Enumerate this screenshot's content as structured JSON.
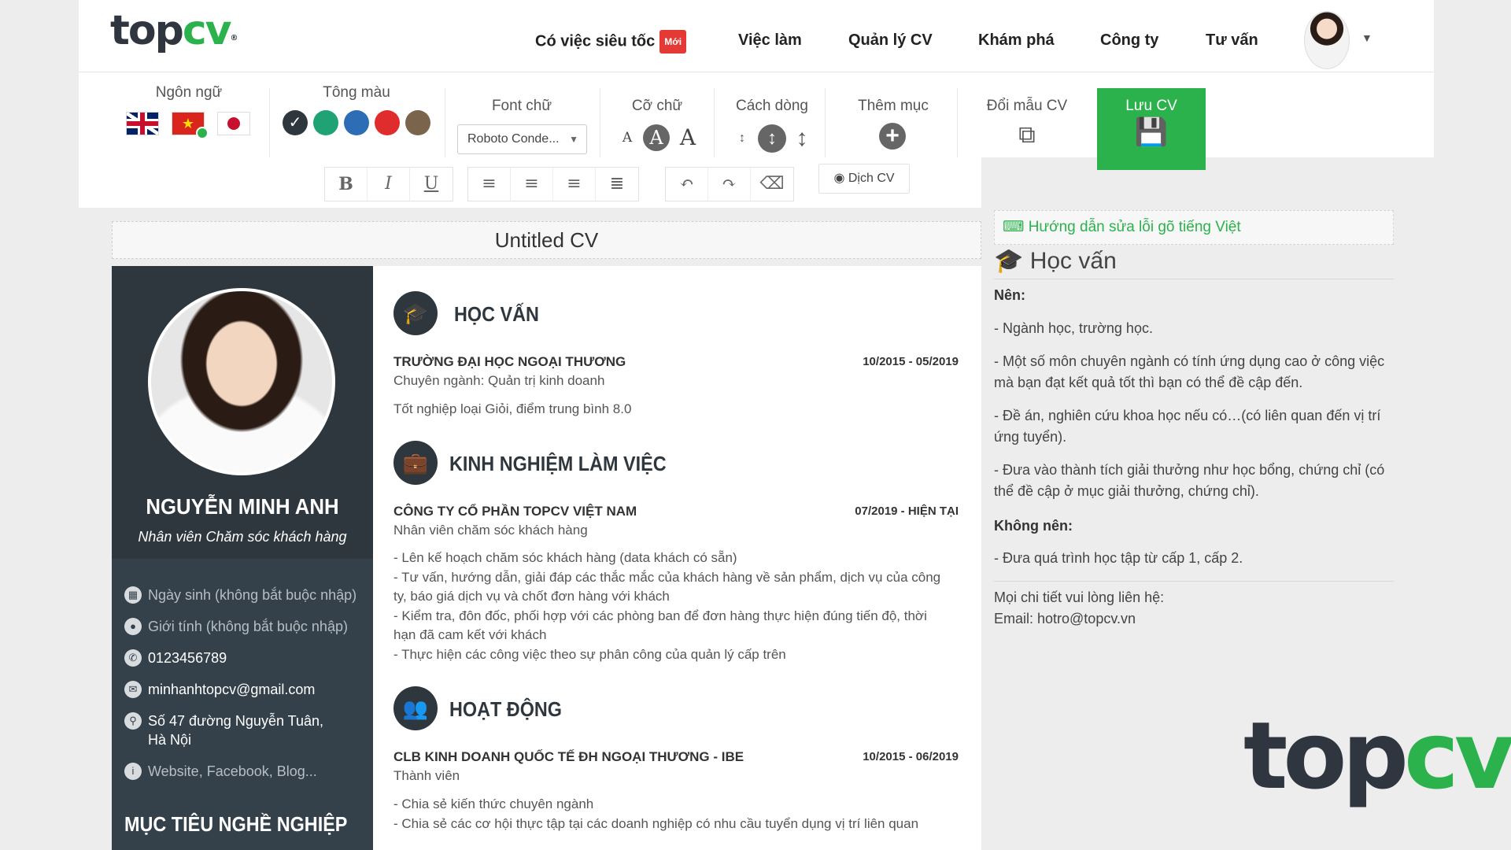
{
  "header": {
    "logo_top": "top",
    "logo_cv": "cv",
    "logo_reg": "®",
    "nav": [
      {
        "label": "Có việc siêu tốc",
        "badge": "Mới"
      },
      {
        "label": "Việc làm"
      },
      {
        "label": "Quản lý CV"
      },
      {
        "label": "Khám phá"
      },
      {
        "label": "Công ty"
      },
      {
        "label": "Tư vấn"
      }
    ],
    "avatar_caret": "▼"
  },
  "toolbar": {
    "language_label": "Ngôn ngữ",
    "color_label": "Tông màu",
    "colors": [
      "#2f373e",
      "#1fa374",
      "#2c6db5",
      "#e02c2c",
      "#7a654c"
    ],
    "font_label": "Font chữ",
    "font_value": "Roboto Conde...",
    "size_label": "Cỡ chữ",
    "spacing_label": "Cách dòng",
    "add_section_label": "Thêm mục",
    "change_template_label": "Đổi mẫu CV",
    "save_label": "Lưu CV",
    "bold": "B",
    "italic": "I",
    "underline": "U",
    "translate_label": "Dịch CV"
  },
  "cv": {
    "title": "Untitled CV",
    "name": "NGUYỄN MINH ANH",
    "role": "Nhân viên Chăm sóc khách hàng",
    "contacts": {
      "birthday": "Ngày sinh (không bắt buộc nhập)",
      "gender": "Giới tính (không bắt buộc nhập)",
      "phone": "0123456789",
      "email": "minhanhtopcv@gmail.com",
      "address": "Số 47 đường Nguyễn Tuân, Hà Nội",
      "website": "Website, Facebook, Blog..."
    },
    "objective_title": "MỤC TIÊU NGHỀ NGHIỆP",
    "education": {
      "title": "HỌC VẤN",
      "org": "TRƯỜNG ĐẠI HỌC NGOẠI THƯƠNG",
      "date": "10/2015 - 05/2019",
      "sub": "Chuyên ngành: Quản trị kinh doanh",
      "desc": "Tốt nghiệp loại Giỏi, điểm trung bình 8.0"
    },
    "experience": {
      "title": "KINH NGHIỆM LÀM VIỆC",
      "org": "CÔNG TY CỔ PHẦN TOPCV VIỆT NAM",
      "date": "07/2019 - HIỆN TẠI",
      "sub": "Nhân viên chăm sóc khách hàng",
      "desc": [
        "- Lên kế hoạch chăm sóc khách hàng (data khách có sẵn)",
        "- Tư vấn, hướng dẫn, giải đáp các thắc mắc của khách hàng về sản phẩm, dịch vụ của công ty, báo giá dịch vụ và chốt đơn hàng với khách",
        "- Kiểm tra, đôn đốc, phối hợp với các phòng ban để đơn hàng thực hiện đúng tiến độ, thời hạn đã cam kết với khách",
        "- Thực hiện các công việc theo sự phân công của quản lý cấp trên"
      ]
    },
    "activities": {
      "title": "HOẠT ĐỘNG",
      "org": "CLB KINH DOANH QUỐC TẾ ĐH NGOẠI THƯƠNG - IBE",
      "date": "10/2015 - 06/2019",
      "sub": "Thành viên",
      "desc": [
        "- Chia sẻ kiến thức chuyên ngành",
        "- Chia sẻ các cơ hội thực tập tại các doanh nghiệp có nhu cầu tuyển dụng vị trí liên quan"
      ]
    }
  },
  "help": {
    "link": "Hướng dẫn sửa lỗi gõ tiếng Việt",
    "title": "Học vấn",
    "should_label": "Nên:",
    "should": [
      "- Ngành học, trường học.",
      "- Một số môn chuyên ngành có tính ứng dụng cao ở công việc mà bạn đạt kết quả tốt thì bạn có thể đề cập đến.",
      "- Đề án, nghiên cứu khoa học nếu có…(có liên quan đến vị trí ứng tuyển).",
      "- Đưa vào thành tích giải thưởng như học bổng, chứng chỉ (có thể đề cập ở mục giải thưởng, chứng chỉ)."
    ],
    "should_not_label": "Không nên:",
    "should_not": [
      "- Đưa quá trình học tập từ cấp 1, cấp 2."
    ],
    "contact_line": "Mọi chi tiết vui lòng liên hệ:",
    "email_line": "Email: hotro@topcv.vn"
  }
}
